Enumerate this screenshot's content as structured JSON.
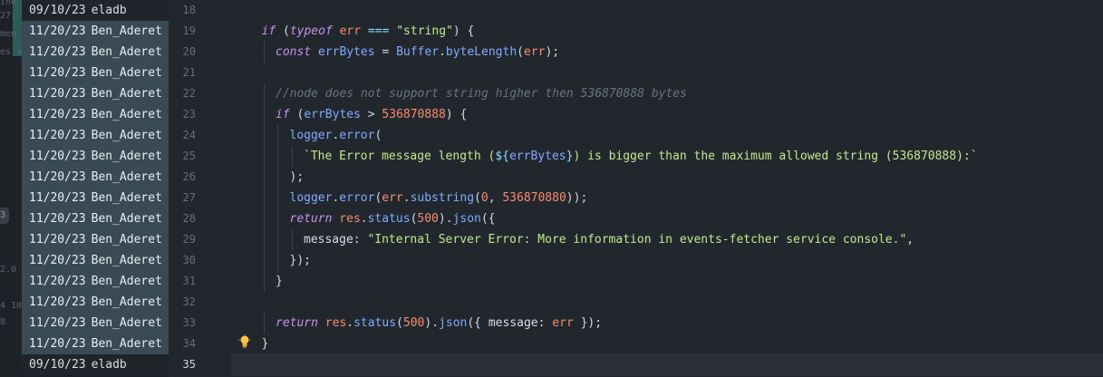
{
  "left_fragments": [
    "ine",
    "27,",
    "men",
    "es a",
    "3",
    "2.0",
    "4 10",
    "8"
  ],
  "blame": [
    {
      "date": "09/10/23",
      "author": "eladb",
      "recent": false
    },
    {
      "date": "11/20/23",
      "author": "Ben_Aderet",
      "recent": true
    },
    {
      "date": "11/20/23",
      "author": "Ben_Aderet",
      "recent": true
    },
    {
      "date": "11/20/23",
      "author": "Ben_Aderet",
      "recent": true
    },
    {
      "date": "11/20/23",
      "author": "Ben_Aderet",
      "recent": true
    },
    {
      "date": "11/20/23",
      "author": "Ben_Aderet",
      "recent": true
    },
    {
      "date": "11/20/23",
      "author": "Ben_Aderet",
      "recent": true
    },
    {
      "date": "11/20/23",
      "author": "Ben_Aderet",
      "recent": true
    },
    {
      "date": "11/20/23",
      "author": "Ben_Aderet",
      "recent": true
    },
    {
      "date": "11/20/23",
      "author": "Ben_Aderet",
      "recent": true
    },
    {
      "date": "11/20/23",
      "author": "Ben_Aderet",
      "recent": true
    },
    {
      "date": "11/20/23",
      "author": "Ben_Aderet",
      "recent": true
    },
    {
      "date": "11/20/23",
      "author": "Ben_Aderet",
      "recent": true
    },
    {
      "date": "11/20/23",
      "author": "Ben_Aderet",
      "recent": true
    },
    {
      "date": "11/20/23",
      "author": "Ben_Aderet",
      "recent": true
    },
    {
      "date": "11/20/23",
      "author": "Ben_Aderet",
      "recent": true
    },
    {
      "date": "11/20/23",
      "author": "Ben_Aderet",
      "recent": true
    },
    {
      "date": "09/10/23",
      "author": "eladb",
      "recent": false
    }
  ],
  "line_numbers": [
    "18",
    "19",
    "20",
    "21",
    "22",
    "23",
    "24",
    "25",
    "26",
    "27",
    "28",
    "29",
    "30",
    "31",
    "32",
    "33",
    "34",
    "35"
  ],
  "active_line": "35",
  "code_lines": [
    {
      "indent": 0,
      "tokens": []
    },
    {
      "indent": 1,
      "tokens": [
        {
          "t": "kw",
          "v": "if"
        },
        {
          "t": "plain",
          "v": " ("
        },
        {
          "t": "kw",
          "v": "typeof"
        },
        {
          "t": "plain",
          "v": " "
        },
        {
          "t": "var",
          "v": "err"
        },
        {
          "t": "plain",
          "v": " "
        },
        {
          "t": "punc",
          "v": "==="
        },
        {
          "t": "plain",
          "v": " "
        },
        {
          "t": "str",
          "v": "\"string\""
        },
        {
          "t": "plain",
          "v": ") {"
        }
      ]
    },
    {
      "indent": 2,
      "tokens": [
        {
          "t": "kw",
          "v": "const"
        },
        {
          "t": "plain",
          "v": " "
        },
        {
          "t": "ident",
          "v": "errBytes"
        },
        {
          "t": "plain",
          "v": " = "
        },
        {
          "t": "ident",
          "v": "Buffer"
        },
        {
          "t": "plain",
          "v": "."
        },
        {
          "t": "ident",
          "v": "byteLength"
        },
        {
          "t": "plain",
          "v": "("
        },
        {
          "t": "var",
          "v": "err"
        },
        {
          "t": "plain",
          "v": ");"
        }
      ]
    },
    {
      "indent": 0,
      "tokens": []
    },
    {
      "indent": 2,
      "tokens": [
        {
          "t": "cmt",
          "v": "//node does not support string higher then 536870888 bytes"
        }
      ]
    },
    {
      "indent": 2,
      "tokens": [
        {
          "t": "kw",
          "v": "if"
        },
        {
          "t": "plain",
          "v": " ("
        },
        {
          "t": "ident",
          "v": "errBytes"
        },
        {
          "t": "plain",
          "v": " > "
        },
        {
          "t": "num",
          "v": "536870888"
        },
        {
          "t": "plain",
          "v": ") {"
        }
      ]
    },
    {
      "indent": 3,
      "tokens": [
        {
          "t": "ident",
          "v": "logger"
        },
        {
          "t": "plain",
          "v": "."
        },
        {
          "t": "ident",
          "v": "error"
        },
        {
          "t": "plain",
          "v": "("
        }
      ]
    },
    {
      "indent": 4,
      "tokens": [
        {
          "t": "str",
          "v": "`The Error message length ("
        },
        {
          "t": "punc",
          "v": "${"
        },
        {
          "t": "ident",
          "v": "errBytes"
        },
        {
          "t": "punc",
          "v": "}"
        },
        {
          "t": "str",
          "v": ") is bigger than the maximum allowed string (536870888):`"
        }
      ]
    },
    {
      "indent": 3,
      "tokens": [
        {
          "t": "plain",
          "v": ");"
        }
      ]
    },
    {
      "indent": 3,
      "tokens": [
        {
          "t": "ident",
          "v": "logger"
        },
        {
          "t": "plain",
          "v": "."
        },
        {
          "t": "ident",
          "v": "error"
        },
        {
          "t": "plain",
          "v": "("
        },
        {
          "t": "var",
          "v": "err"
        },
        {
          "t": "plain",
          "v": "."
        },
        {
          "t": "ident",
          "v": "substring"
        },
        {
          "t": "plain",
          "v": "("
        },
        {
          "t": "num",
          "v": "0"
        },
        {
          "t": "plain",
          "v": ", "
        },
        {
          "t": "num",
          "v": "536870880"
        },
        {
          "t": "plain",
          "v": "));"
        }
      ]
    },
    {
      "indent": 3,
      "tokens": [
        {
          "t": "kw",
          "v": "return"
        },
        {
          "t": "plain",
          "v": " "
        },
        {
          "t": "var",
          "v": "res"
        },
        {
          "t": "plain",
          "v": "."
        },
        {
          "t": "ident",
          "v": "status"
        },
        {
          "t": "plain",
          "v": "("
        },
        {
          "t": "num",
          "v": "500"
        },
        {
          "t": "plain",
          "v": ")."
        },
        {
          "t": "ident",
          "v": "json"
        },
        {
          "t": "plain",
          "v": "({"
        }
      ]
    },
    {
      "indent": 4,
      "tokens": [
        {
          "t": "prop",
          "v": "message"
        },
        {
          "t": "plain",
          "v": ": "
        },
        {
          "t": "str",
          "v": "\"Internal Server Error: More information in events-fetcher service console.\""
        },
        {
          "t": "plain",
          "v": ","
        }
      ]
    },
    {
      "indent": 3,
      "tokens": [
        {
          "t": "plain",
          "v": "});"
        }
      ]
    },
    {
      "indent": 2,
      "tokens": [
        {
          "t": "plain",
          "v": "}"
        }
      ]
    },
    {
      "indent": 0,
      "tokens": []
    },
    {
      "indent": 2,
      "tokens": [
        {
          "t": "kw",
          "v": "return"
        },
        {
          "t": "plain",
          "v": " "
        },
        {
          "t": "var",
          "v": "res"
        },
        {
          "t": "plain",
          "v": "."
        },
        {
          "t": "ident",
          "v": "status"
        },
        {
          "t": "plain",
          "v": "("
        },
        {
          "t": "num",
          "v": "500"
        },
        {
          "t": "plain",
          "v": ")."
        },
        {
          "t": "ident",
          "v": "json"
        },
        {
          "t": "plain",
          "v": "({ "
        },
        {
          "t": "prop",
          "v": "message"
        },
        {
          "t": "plain",
          "v": ": "
        },
        {
          "t": "var",
          "v": "err"
        },
        {
          "t": "plain",
          "v": " });"
        }
      ]
    },
    {
      "indent": 1,
      "tokens": [
        {
          "t": "plain",
          "v": "}"
        }
      ]
    },
    {
      "indent": 0,
      "tokens": []
    }
  ],
  "icons": {
    "lightbulb": "lightbulb-icon"
  },
  "colors": {
    "blame_recent": "#3a4a55",
    "keyword": "#c792ea",
    "string": "#c3e88d",
    "number": "#f78c6c"
  }
}
